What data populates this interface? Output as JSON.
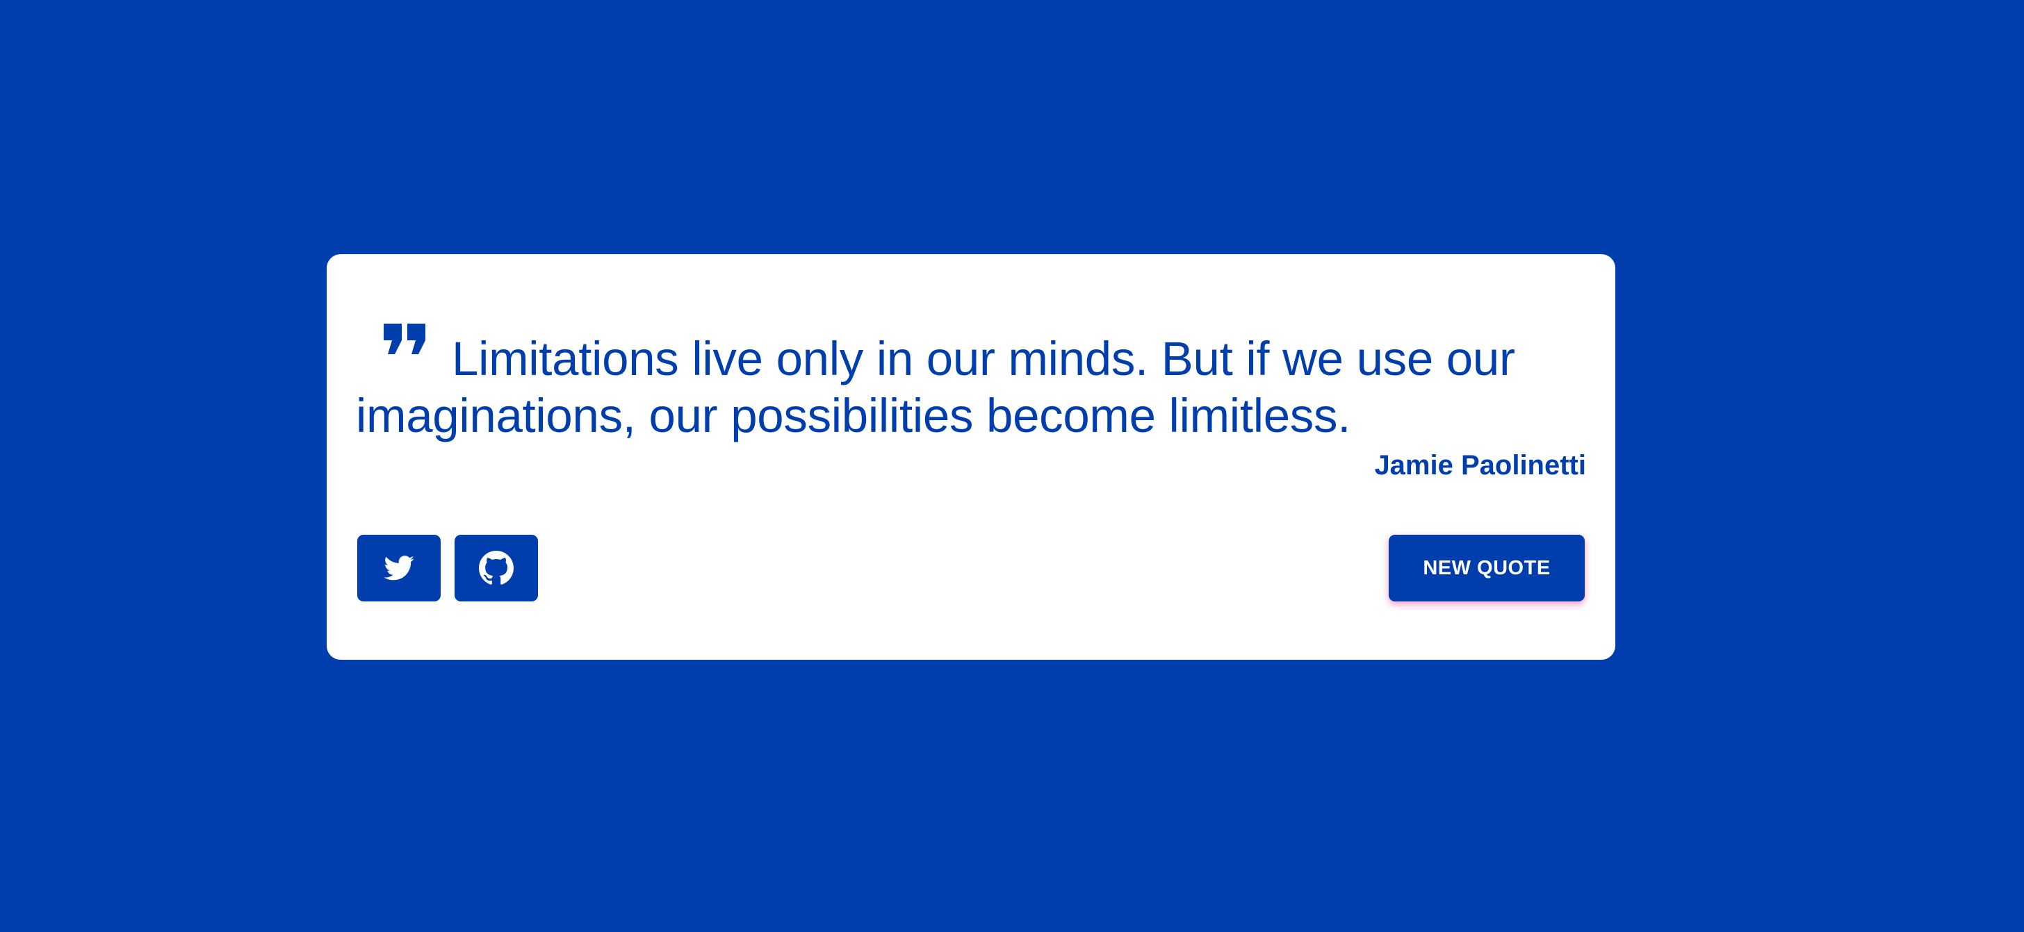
{
  "colors": {
    "background": "#003DAD",
    "card": "#FFFFFF",
    "accent": "#003DAD",
    "button_shadow": "#F04696"
  },
  "quote": {
    "icon": "quote-right-icon",
    "text": "Limitations live only in our minds. But if we use our imaginations, our possibilities become limitless.",
    "author": "Jamie Paolinetti"
  },
  "actions": {
    "twitter_icon": "twitter-icon",
    "github_icon": "github-icon",
    "new_quote_label": "NEW QUOTE"
  }
}
